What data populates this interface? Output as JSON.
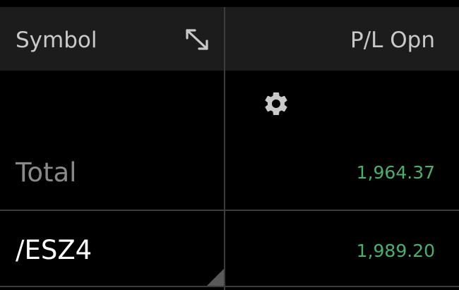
{
  "header": {
    "symbol_label": "Symbol",
    "pl_label": "P/L Opn"
  },
  "icons": {
    "expand": "expand-diagonal-icon",
    "settings": "gear-icon",
    "resize": "corner-triangle-icon"
  },
  "rows": [
    {
      "label": "Total",
      "value": "1,964.37"
    },
    {
      "label": "/ESZ4",
      "value": "1,989.20"
    }
  ],
  "colors": {
    "background": "#000000",
    "header_background": "#1c1c1c",
    "divider": "#3c3c3c",
    "positive": "#4caf6a",
    "label_muted": "#8a8a8a",
    "symbol_text": "#ffffff",
    "header_text": "#c9c9c9"
  }
}
